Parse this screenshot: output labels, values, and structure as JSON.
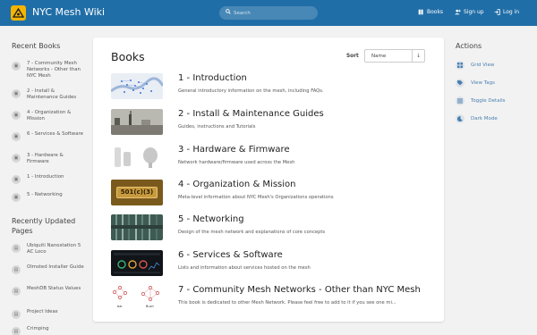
{
  "header": {
    "brand": "NYC Mesh Wiki",
    "search_placeholder": "Search",
    "nav": {
      "books": "Books",
      "signup": "Sign up",
      "login": "Log in"
    }
  },
  "left": {
    "recent_books_title": "Recent Books",
    "recent_books": [
      "7 - Community Mesh Networks - Other than NYC Mesh",
      "2 - Install & Maintenance Guides",
      "4 - Organization & Mission",
      "6 - Services & Software",
      "3 - Hardware & Firmware",
      "1 - Introduction",
      "5 - Networking"
    ],
    "recent_pages_title": "Recently Updated Pages",
    "recent_pages": [
      "Ubiquiti Nanostation 5 AC Loco",
      "Olmsted Installer Guide",
      "MeshDB Status Values",
      "Project Ideas",
      "Crimping"
    ]
  },
  "main": {
    "title": "Books",
    "sort_label": "Sort",
    "sort_value": "Name",
    "sort_dir": "↓",
    "books": [
      {
        "title": "1 - Introduction",
        "desc": "General introductory information on the mesh, including FAQs."
      },
      {
        "title": "2 - Install & Maintenance Guides",
        "desc": "Guides, instructions and Tutorials"
      },
      {
        "title": "3 - Hardware & Firmware",
        "desc": "Network hardware/firmware used across the Mesh"
      },
      {
        "title": "4 - Organization & Mission",
        "desc": "Meta-level information about NYC Mesh's Organizations operations",
        "thumb_text": "501(c)(3)"
      },
      {
        "title": "5 - Networking",
        "desc": "Design of the mesh network and explanations of core concepts"
      },
      {
        "title": "6 - Services & Software",
        "desc": "Lists and information about services hosted on the mesh"
      },
      {
        "title": "7 - Community Mesh Networks - Other than NYC Mesh",
        "desc": "This book is dedicated to other Mesh Network. Please feel free to add to it if you see one mi...",
        "thumb_text_a": "bar",
        "thumb_text_b": "Bush"
      }
    ]
  },
  "right": {
    "title": "Actions",
    "actions": [
      "Grid View",
      "View Tags",
      "Toggle Details",
      "Dark Mode"
    ]
  },
  "colors": {
    "header": "#206ea7",
    "accent": "#4a7fb0",
    "background": "#f2f2f2"
  }
}
